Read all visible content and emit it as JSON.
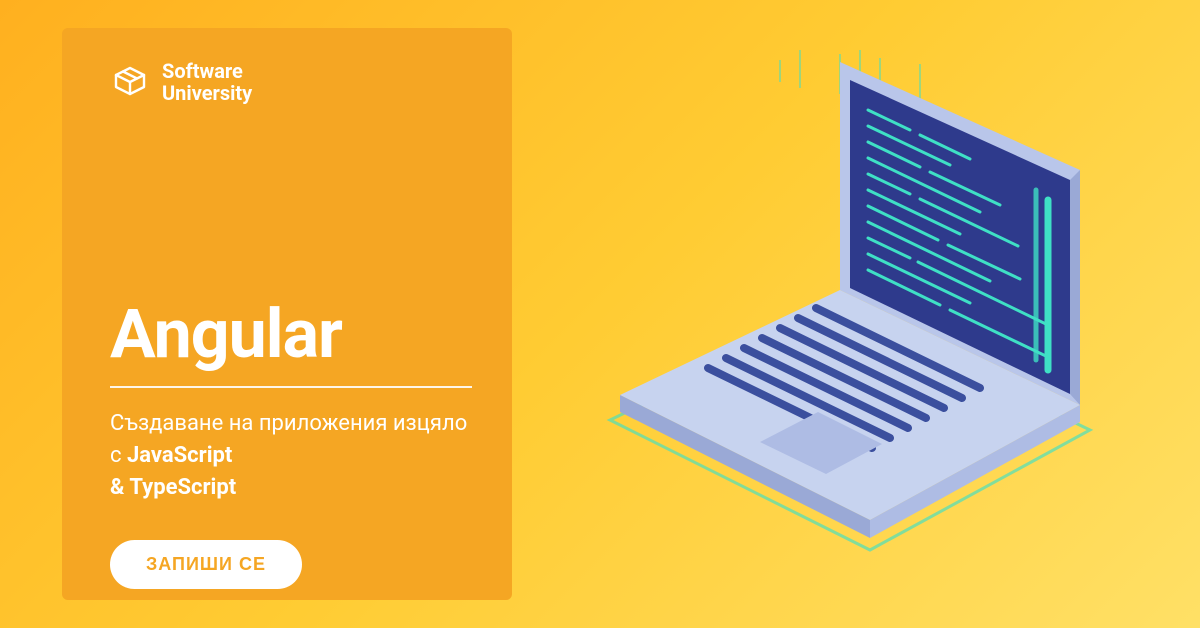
{
  "logo": {
    "line1": "Software",
    "line2": "University"
  },
  "title": "Angular",
  "subtitle": {
    "plain1": "Създаване на приложения изцяло с ",
    "bold1": "JavaScript",
    "amp": " & ",
    "bold2": "TypeScript"
  },
  "cta_label": "ЗАПИШИ СЕ",
  "colors": {
    "panel": "#f5a623",
    "cta_text": "#f5a623",
    "cta_bg": "#ffffff",
    "laptop_body": "#c7d3ef",
    "laptop_dark": "#3b4f9e",
    "screen": "#2e3a8c",
    "code": "#3fe0c5"
  },
  "icon_name": "open-box-icon"
}
